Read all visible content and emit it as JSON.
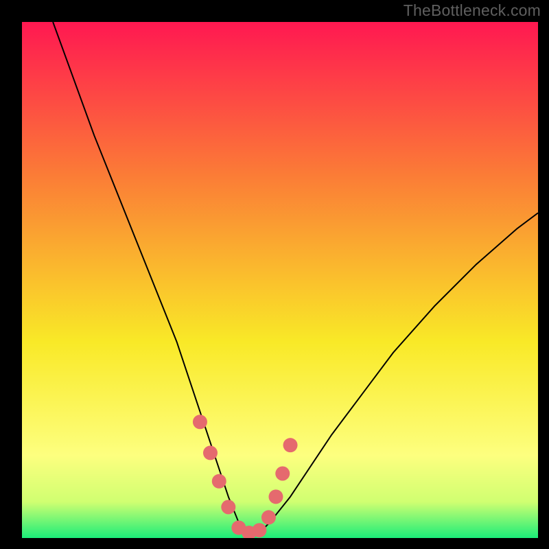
{
  "watermark": "TheBottleneck.com",
  "chart_data": {
    "type": "line",
    "title": "",
    "xlabel": "",
    "ylabel": "",
    "xlim": [
      0,
      100
    ],
    "ylim": [
      0,
      100
    ],
    "grid": false,
    "legend": false,
    "background_gradient": {
      "top": "#ff1851",
      "mid_upper": "#fb7d36",
      "mid": "#f9e927",
      "mid_lower": "#fdff7f",
      "near_bottom": "#d0ff71",
      "bottom": "#1bed79"
    },
    "series": [
      {
        "name": "bottleneck-curve",
        "type": "line",
        "color": "#000000",
        "stroke_width": 2,
        "x": [
          6,
          10,
          14,
          18,
          22,
          26,
          30,
          34,
          36,
          38,
          40,
          42,
          44,
          46,
          48,
          52,
          56,
          60,
          66,
          72,
          80,
          88,
          96,
          100
        ],
        "y": [
          100,
          89,
          78,
          68,
          58,
          48,
          38,
          26,
          20,
          14,
          8,
          3,
          1,
          1,
          3,
          8,
          14,
          20,
          28,
          36,
          45,
          53,
          60,
          63
        ]
      },
      {
        "name": "highlight-marks",
        "type": "scatter",
        "color": "#e56a6e",
        "marker_size_px": 21,
        "x": [
          34.5,
          36.5,
          38.2,
          40.0,
          42.0,
          44.0,
          46.0,
          47.8,
          49.2,
          50.5,
          52.0
        ],
        "y": [
          22.5,
          16.5,
          11.0,
          6.0,
          2.0,
          1.0,
          1.5,
          4.0,
          8.0,
          12.5,
          18.0
        ]
      }
    ]
  }
}
